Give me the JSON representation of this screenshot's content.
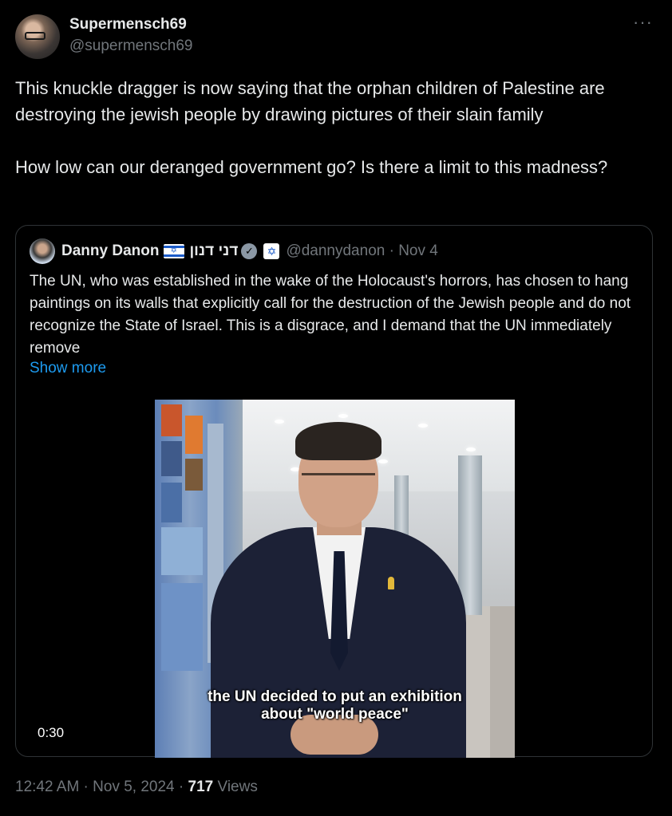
{
  "author": {
    "display_name": "Supermensch69",
    "handle": "@supermensch69"
  },
  "more_icon": "···",
  "tweet": {
    "paragraphs": [
      "This knuckle dragger is now saying that the orphan children of Palestine are destroying the jewish people by drawing pictures of their slain family",
      "How low can our deranged government go? Is there a limit to this madness?"
    ]
  },
  "quote": {
    "display_name": "Danny Danon",
    "flag_icon": "israel-flag-icon",
    "hebrew_name": "דני דנון",
    "verified_icon": "✓",
    "affiliation_icon": "✡",
    "handle_date": "@dannydanon · Nov 4",
    "text": "The UN, who was established in the wake of the Holocaust's horrors, has chosen to hang paintings on its walls that explicitly call for the destruction of the Jewish people and do not recognize the State of Israel. This is a disgrace, and I demand that the UN immediately remove",
    "show_more": "Show more",
    "video": {
      "caption_line1": "the UN decided to put an exhibition",
      "caption_line2": "about \"world peace\"",
      "duration": "0:30"
    }
  },
  "footer": {
    "time_date": "12:42 AM · Nov 5, 2024 · ",
    "views_count": "717",
    "views_label": " Views"
  },
  "colors": {
    "background": "#000000",
    "text": "#e7e9ea",
    "muted": "#71767b",
    "link": "#1d9bf0",
    "border": "#2f3336"
  }
}
